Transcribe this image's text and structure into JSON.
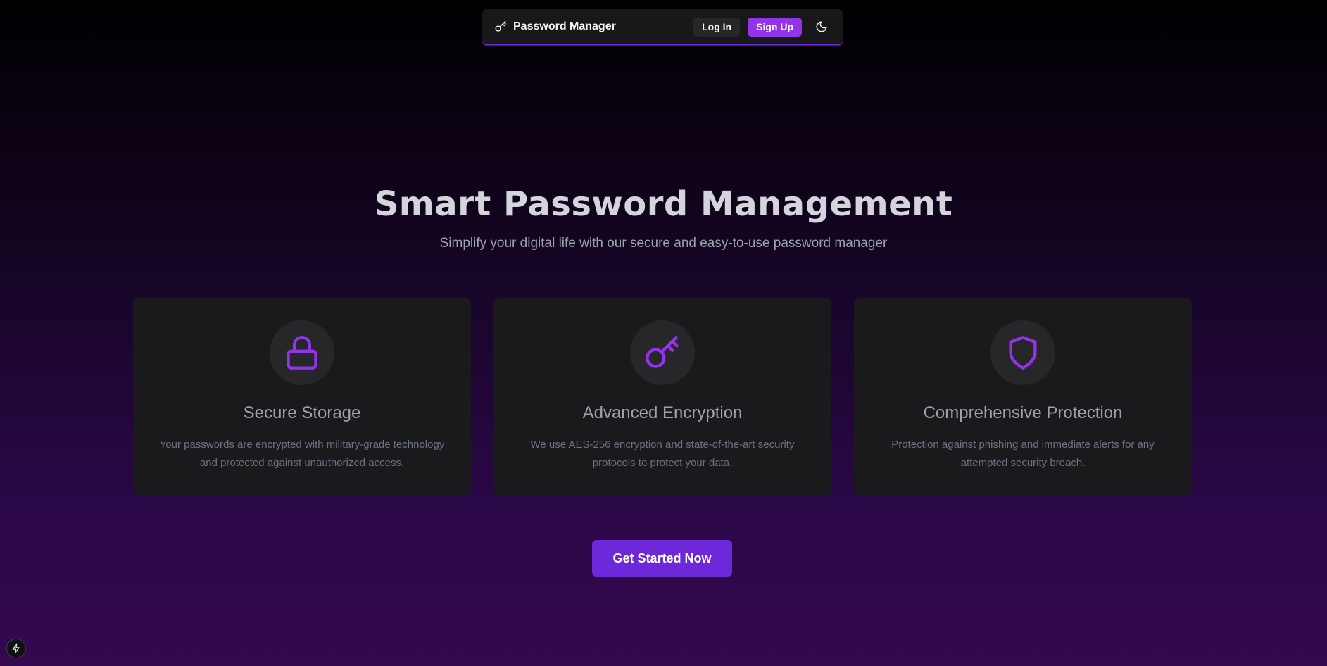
{
  "navbar": {
    "brand_label": "Password Manager",
    "brand_icon": "key-icon",
    "login_label": "Log In",
    "signup_label": "Sign Up",
    "theme_icon": "moon-icon"
  },
  "hero": {
    "title": "Smart Password Management",
    "subtitle": "Simplify your digital life with our secure and easy-to-use password manager"
  },
  "features": [
    {
      "icon": "lock-icon",
      "title": "Secure Storage",
      "description": "Your passwords are encrypted with military-grade technology and protected against unauthorized access."
    },
    {
      "icon": "key-icon",
      "title": "Advanced Encryption",
      "description": "We use AES-256 encryption and state-of-the-art security protocols to protect your data."
    },
    {
      "icon": "shield-icon",
      "title": "Comprehensive Protection",
      "description": "Protection against phishing and immediate alerts for any attempted security breach."
    }
  ],
  "cta": {
    "label": "Get Started Now"
  },
  "corner_badge": {
    "icon": "lightning-icon"
  },
  "colors": {
    "accent": "#9333ea",
    "accent_dark": "#6d28d9",
    "card_background": "#1a1a1d",
    "icon_color": "#9333ea"
  }
}
